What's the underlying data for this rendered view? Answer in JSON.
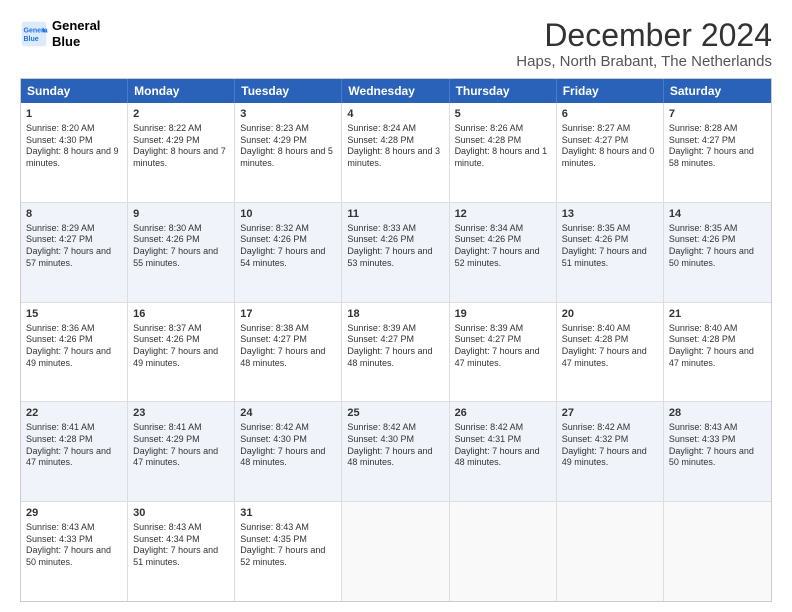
{
  "logo": {
    "line1": "General",
    "line2": "Blue"
  },
  "title": "December 2024",
  "subtitle": "Haps, North Brabant, The Netherlands",
  "header_days": [
    "Sunday",
    "Monday",
    "Tuesday",
    "Wednesday",
    "Thursday",
    "Friday",
    "Saturday"
  ],
  "rows": [
    [
      {
        "day": "1",
        "sunrise": "Sunrise: 8:20 AM",
        "sunset": "Sunset: 4:30 PM",
        "daylight": "Daylight: 8 hours and 9 minutes."
      },
      {
        "day": "2",
        "sunrise": "Sunrise: 8:22 AM",
        "sunset": "Sunset: 4:29 PM",
        "daylight": "Daylight: 8 hours and 7 minutes."
      },
      {
        "day": "3",
        "sunrise": "Sunrise: 8:23 AM",
        "sunset": "Sunset: 4:29 PM",
        "daylight": "Daylight: 8 hours and 5 minutes."
      },
      {
        "day": "4",
        "sunrise": "Sunrise: 8:24 AM",
        "sunset": "Sunset: 4:28 PM",
        "daylight": "Daylight: 8 hours and 3 minutes."
      },
      {
        "day": "5",
        "sunrise": "Sunrise: 8:26 AM",
        "sunset": "Sunset: 4:28 PM",
        "daylight": "Daylight: 8 hours and 1 minute."
      },
      {
        "day": "6",
        "sunrise": "Sunrise: 8:27 AM",
        "sunset": "Sunset: 4:27 PM",
        "daylight": "Daylight: 8 hours and 0 minutes."
      },
      {
        "day": "7",
        "sunrise": "Sunrise: 8:28 AM",
        "sunset": "Sunset: 4:27 PM",
        "daylight": "Daylight: 7 hours and 58 minutes."
      }
    ],
    [
      {
        "day": "8",
        "sunrise": "Sunrise: 8:29 AM",
        "sunset": "Sunset: 4:27 PM",
        "daylight": "Daylight: 7 hours and 57 minutes."
      },
      {
        "day": "9",
        "sunrise": "Sunrise: 8:30 AM",
        "sunset": "Sunset: 4:26 PM",
        "daylight": "Daylight: 7 hours and 55 minutes."
      },
      {
        "day": "10",
        "sunrise": "Sunrise: 8:32 AM",
        "sunset": "Sunset: 4:26 PM",
        "daylight": "Daylight: 7 hours and 54 minutes."
      },
      {
        "day": "11",
        "sunrise": "Sunrise: 8:33 AM",
        "sunset": "Sunset: 4:26 PM",
        "daylight": "Daylight: 7 hours and 53 minutes."
      },
      {
        "day": "12",
        "sunrise": "Sunrise: 8:34 AM",
        "sunset": "Sunset: 4:26 PM",
        "daylight": "Daylight: 7 hours and 52 minutes."
      },
      {
        "day": "13",
        "sunrise": "Sunrise: 8:35 AM",
        "sunset": "Sunset: 4:26 PM",
        "daylight": "Daylight: 7 hours and 51 minutes."
      },
      {
        "day": "14",
        "sunrise": "Sunrise: 8:35 AM",
        "sunset": "Sunset: 4:26 PM",
        "daylight": "Daylight: 7 hours and 50 minutes."
      }
    ],
    [
      {
        "day": "15",
        "sunrise": "Sunrise: 8:36 AM",
        "sunset": "Sunset: 4:26 PM",
        "daylight": "Daylight: 7 hours and 49 minutes."
      },
      {
        "day": "16",
        "sunrise": "Sunrise: 8:37 AM",
        "sunset": "Sunset: 4:26 PM",
        "daylight": "Daylight: 7 hours and 49 minutes."
      },
      {
        "day": "17",
        "sunrise": "Sunrise: 8:38 AM",
        "sunset": "Sunset: 4:27 PM",
        "daylight": "Daylight: 7 hours and 48 minutes."
      },
      {
        "day": "18",
        "sunrise": "Sunrise: 8:39 AM",
        "sunset": "Sunset: 4:27 PM",
        "daylight": "Daylight: 7 hours and 48 minutes."
      },
      {
        "day": "19",
        "sunrise": "Sunrise: 8:39 AM",
        "sunset": "Sunset: 4:27 PM",
        "daylight": "Daylight: 7 hours and 47 minutes."
      },
      {
        "day": "20",
        "sunrise": "Sunrise: 8:40 AM",
        "sunset": "Sunset: 4:28 PM",
        "daylight": "Daylight: 7 hours and 47 minutes."
      },
      {
        "day": "21",
        "sunrise": "Sunrise: 8:40 AM",
        "sunset": "Sunset: 4:28 PM",
        "daylight": "Daylight: 7 hours and 47 minutes."
      }
    ],
    [
      {
        "day": "22",
        "sunrise": "Sunrise: 8:41 AM",
        "sunset": "Sunset: 4:28 PM",
        "daylight": "Daylight: 7 hours and 47 minutes."
      },
      {
        "day": "23",
        "sunrise": "Sunrise: 8:41 AM",
        "sunset": "Sunset: 4:29 PM",
        "daylight": "Daylight: 7 hours and 47 minutes."
      },
      {
        "day": "24",
        "sunrise": "Sunrise: 8:42 AM",
        "sunset": "Sunset: 4:30 PM",
        "daylight": "Daylight: 7 hours and 48 minutes."
      },
      {
        "day": "25",
        "sunrise": "Sunrise: 8:42 AM",
        "sunset": "Sunset: 4:30 PM",
        "daylight": "Daylight: 7 hours and 48 minutes."
      },
      {
        "day": "26",
        "sunrise": "Sunrise: 8:42 AM",
        "sunset": "Sunset: 4:31 PM",
        "daylight": "Daylight: 7 hours and 48 minutes."
      },
      {
        "day": "27",
        "sunrise": "Sunrise: 8:42 AM",
        "sunset": "Sunset: 4:32 PM",
        "daylight": "Daylight: 7 hours and 49 minutes."
      },
      {
        "day": "28",
        "sunrise": "Sunrise: 8:43 AM",
        "sunset": "Sunset: 4:33 PM",
        "daylight": "Daylight: 7 hours and 50 minutes."
      }
    ],
    [
      {
        "day": "29",
        "sunrise": "Sunrise: 8:43 AM",
        "sunset": "Sunset: 4:33 PM",
        "daylight": "Daylight: 7 hours and 50 minutes."
      },
      {
        "day": "30",
        "sunrise": "Sunrise: 8:43 AM",
        "sunset": "Sunset: 4:34 PM",
        "daylight": "Daylight: 7 hours and 51 minutes."
      },
      {
        "day": "31",
        "sunrise": "Sunrise: 8:43 AM",
        "sunset": "Sunset: 4:35 PM",
        "daylight": "Daylight: 7 hours and 52 minutes."
      },
      null,
      null,
      null,
      null
    ]
  ]
}
